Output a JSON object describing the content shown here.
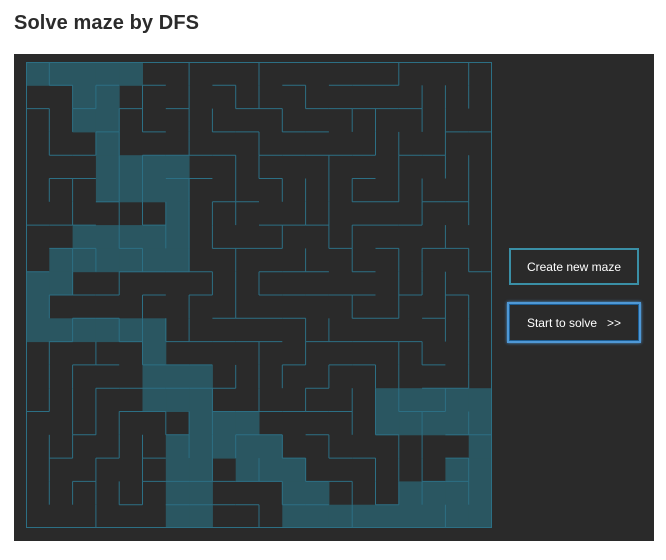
{
  "page": {
    "title": "Solve maze by DFS"
  },
  "controls": {
    "create_label": "Create new maze",
    "solve_label": "Start to solve",
    "solve_arrow": ">>"
  },
  "colors": {
    "background": "#2a2a2a",
    "wall": "#2c6f84",
    "visited_cell": "#2a5661",
    "create_border": "#3a8fa6",
    "solve_border": "#4f98d6"
  },
  "maze": {
    "rows": 20,
    "cols": 20,
    "visited": [
      [
        0,
        0
      ],
      [
        1,
        0
      ],
      [
        2,
        0
      ],
      [
        3,
        0
      ],
      [
        4,
        0
      ],
      [
        2,
        1
      ],
      [
        2,
        2
      ],
      [
        3,
        1
      ],
      [
        3,
        2
      ],
      [
        3,
        3
      ],
      [
        3,
        4
      ],
      [
        3,
        5
      ],
      [
        4,
        4
      ],
      [
        4,
        5
      ],
      [
        5,
        4
      ],
      [
        5,
        5
      ],
      [
        6,
        4
      ],
      [
        6,
        5
      ],
      [
        6,
        6
      ],
      [
        6,
        7
      ],
      [
        5,
        7
      ],
      [
        4,
        7
      ],
      [
        3,
        7
      ],
      [
        2,
        7
      ],
      [
        1,
        8
      ],
      [
        1,
        9
      ],
      [
        0,
        9
      ],
      [
        0,
        10
      ],
      [
        0,
        11
      ],
      [
        1,
        11
      ],
      [
        2,
        11
      ],
      [
        3,
        11
      ],
      [
        4,
        11
      ],
      [
        5,
        11
      ],
      [
        2,
        8
      ],
      [
        3,
        8
      ],
      [
        4,
        8
      ],
      [
        5,
        8
      ],
      [
        6,
        8
      ],
      [
        5,
        12
      ],
      [
        5,
        13
      ],
      [
        6,
        13
      ],
      [
        7,
        13
      ],
      [
        7,
        14
      ],
      [
        6,
        14
      ],
      [
        5,
        14
      ],
      [
        7,
        15
      ],
      [
        7,
        16
      ],
      [
        7,
        17
      ],
      [
        7,
        18
      ],
      [
        7,
        19
      ],
      [
        6,
        16
      ],
      [
        6,
        17
      ],
      [
        6,
        18
      ],
      [
        6,
        19
      ],
      [
        8,
        15
      ],
      [
        9,
        15
      ],
      [
        9,
        16
      ],
      [
        10,
        16
      ],
      [
        10,
        17
      ],
      [
        11,
        17
      ],
      [
        11,
        18
      ],
      [
        11,
        19
      ],
      [
        12,
        18
      ],
      [
        12,
        19
      ],
      [
        13,
        19
      ],
      [
        14,
        19
      ],
      [
        15,
        19
      ],
      [
        16,
        19
      ],
      [
        17,
        19
      ],
      [
        18,
        19
      ],
      [
        19,
        19
      ],
      [
        16,
        18
      ],
      [
        17,
        18
      ],
      [
        18,
        18
      ],
      [
        19,
        18
      ],
      [
        19,
        17
      ],
      [
        18,
        17
      ],
      [
        19,
        16
      ],
      [
        19,
        15
      ],
      [
        18,
        15
      ],
      [
        17,
        15
      ],
      [
        16,
        15
      ],
      [
        15,
        15
      ],
      [
        15,
        14
      ],
      [
        16,
        14
      ],
      [
        17,
        14
      ],
      [
        18,
        14
      ],
      [
        19,
        14
      ],
      [
        8,
        16
      ],
      [
        9,
        17
      ]
    ]
  }
}
